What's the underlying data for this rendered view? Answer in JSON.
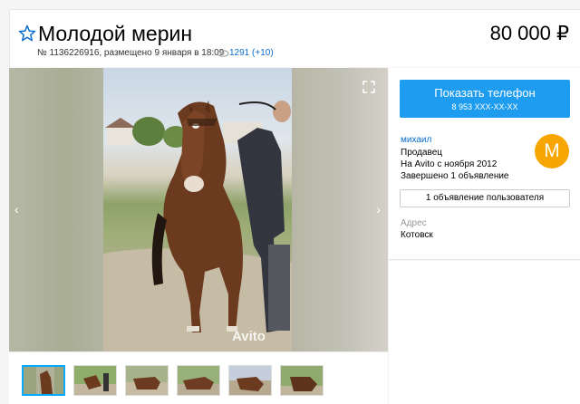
{
  "listing": {
    "title": "Молодой мерин",
    "meta": "№ 1136226916, размещено 9 января в 18:09",
    "views": "1291 (+10)",
    "price": "80 000 ₽"
  },
  "gallery": {
    "watermark": "Avito",
    "arrow_left": "‹",
    "arrow_right": "›",
    "thumbnail_count": 6,
    "active_thumbnail_index": 0
  },
  "sidebar": {
    "phone_button_label": "Показать телефон",
    "phone_number_masked": "8 953 XXX-XX-XX",
    "seller": {
      "name": "михаил",
      "role": "Продавец",
      "since": "На Avito с ноября 2012",
      "completed": "Завершено 1 объявление",
      "avatar_letter": "M"
    },
    "user_ads_button_label": "1 объявление пользователя",
    "address_label": "Адрес",
    "address_value": "Котовск"
  },
  "colors": {
    "accent_blue": "#1e9cf0",
    "link_blue": "#0a6ccc",
    "avatar_orange": "#f7a500"
  }
}
